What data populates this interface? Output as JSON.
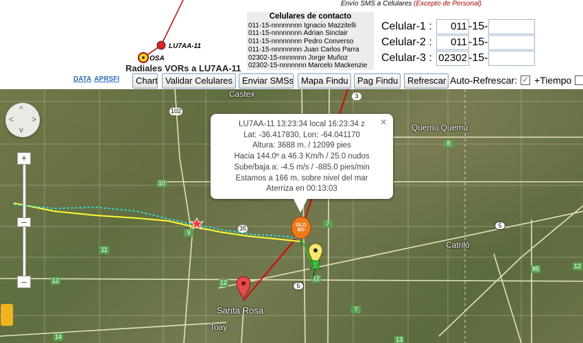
{
  "header": {
    "sms_title": "Envío SMS a Celulares",
    "sms_note": "(Excepto de Personal)"
  },
  "contacts": {
    "title": "Celulares de contacto",
    "rows": [
      "011-15-nnnnnnnn Ignacio Mazzitelli",
      "011-15-nnnnnnnn Adrian Sinclair",
      "011-15-nnnnnnnn Pedro Converso",
      "011-15-nnnnnnnn Juan Carlos Parra",
      "02302-15-nnnnnnn Jorge Muñoz",
      "02302-15-nnnnnnn Marcelo Mackenzie"
    ]
  },
  "cellphones": [
    {
      "label": "Celular-1 :",
      "prefix": "011",
      "sep": "-15-",
      "number": ""
    },
    {
      "label": "Celular-2 :",
      "prefix": "011",
      "sep": "-15-",
      "number": ""
    },
    {
      "label": "Celular-3 :",
      "prefix": "02302",
      "sep": "-15-",
      "number": ""
    }
  ],
  "legend": {
    "callsign": "LU7AA-11",
    "vor": "OSA",
    "title": "Radiales VORs a LU7AA-11"
  },
  "links": [
    "DATA",
    "APRSFI"
  ],
  "toolbar": {
    "buttons": [
      "Chart",
      "Validar Celulares",
      "Enviar SMSs",
      "Mapa Findu",
      "Pag Findu",
      "Refrescar"
    ],
    "auto_refresh_label": "Auto-Refrescar:",
    "auto_refresh_checked": true,
    "tiempo_label": "+Tiempo",
    "tiempo_checked": false
  },
  "map": {
    "places": [
      "Castex",
      "Quemú Quemú",
      "Catriló",
      "Santa Rosa",
      "Toay"
    ],
    "roads": [
      "102",
      "3",
      "8",
      "10",
      "7",
      "35",
      "9",
      "11",
      "5",
      "7",
      "12",
      "5",
      "85",
      "12",
      "12",
      "14",
      "13",
      "12"
    ],
    "balloon_label": "GLOBO"
  },
  "info_window": {
    "lines": [
      "LU7AA-11 13:23:34 local 16:23:34 z",
      "Lat: -36.417830, Lon: -64.041170",
      "Altura: 3688 m. / 12099 pies",
      "Hacia 144.0º a 46.3 Km/h / 25.0 nudos",
      "Sube/baja a: -4.5 m/s / -885.0 pies/min",
      "Estamos a 166 m. sobre nivel del mar",
      "Aterriza en 00:13:03"
    ],
    "close": "×"
  },
  "colors": {
    "link": "#2a6fbf",
    "warning": "#c00000",
    "track": "#ffff33",
    "track_markers": "#33e0e0",
    "radial": "#e00000"
  }
}
